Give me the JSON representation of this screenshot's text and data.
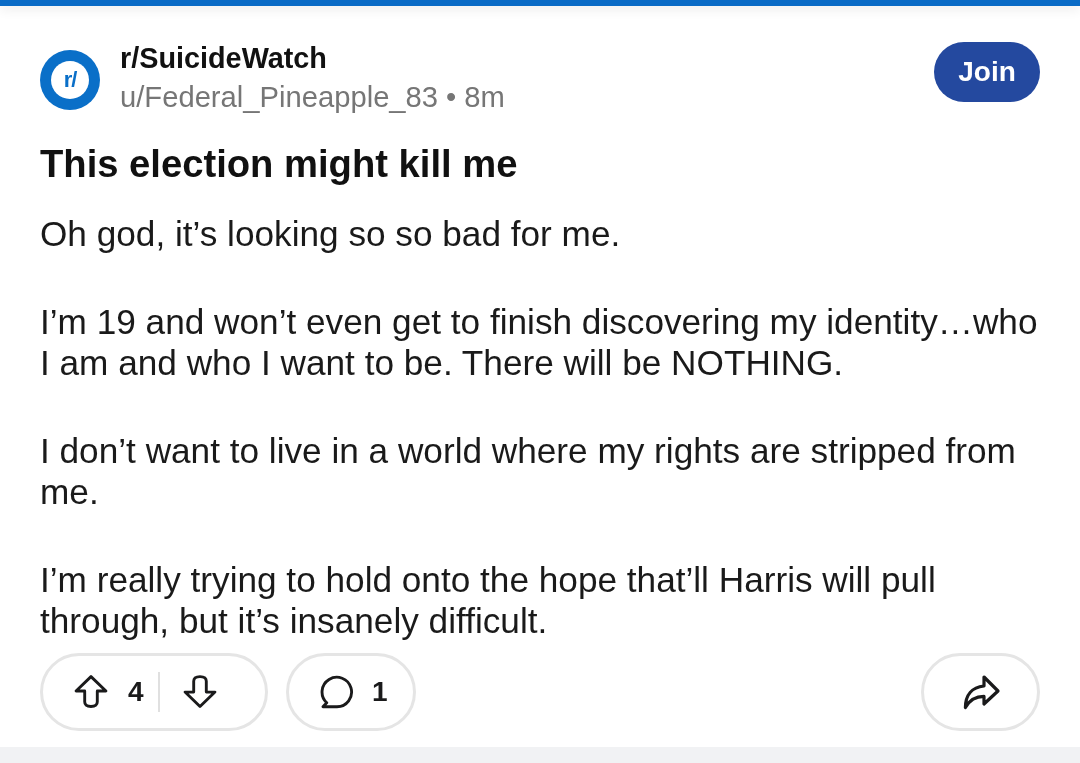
{
  "post": {
    "subreddit": {
      "icon_text": "r/",
      "name": "r/SuicideWatch"
    },
    "author": "u/Federal_Pineapple_83",
    "separator": "•",
    "age": "8m",
    "join_button": "Join",
    "title": "This election might kill me",
    "body": [
      "Oh god, it’s looking so so bad for me.",
      "I’m 19 and won’t even get to finish discovering my identity…who I am and who I want to be. There will be NOTHING.",
      "I don’t want to live in a world where my rights are stripped from me.",
      "I’m really trying to hold onto the hope that’ll Harris will pull through, but it’s insanely difficult."
    ],
    "votes": "4",
    "comments": "1"
  }
}
